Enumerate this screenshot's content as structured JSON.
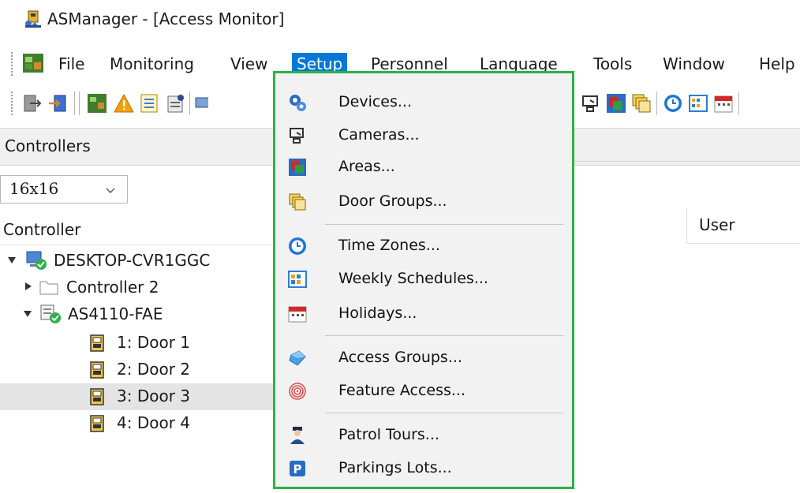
{
  "window": {
    "title": "ASManager - [Access Monitor]",
    "app_icon": "access-manager-app-icon"
  },
  "menubar": {
    "items": [
      {
        "label": "File"
      },
      {
        "label": "Monitoring"
      },
      {
        "label": "View"
      },
      {
        "label": "Setup"
      },
      {
        "label": "Personnel"
      },
      {
        "label": "Language"
      },
      {
        "label": "Tools"
      },
      {
        "label": "Window"
      },
      {
        "label": "Help"
      }
    ]
  },
  "toolbar": {
    "icons": [
      "logout-icon",
      "login-icon",
      "monitor-icon",
      "alarm-warning-icon",
      "list-icon",
      "report-icon",
      "camera-icon",
      "area-icon",
      "door-group-icon",
      "clock-icon",
      "schedule-icon",
      "calendar-icon"
    ]
  },
  "left_panel": {
    "header": "Controllers",
    "icon_size_select": {
      "value": "16x16"
    },
    "column_controller": "Controller",
    "column_user": "User",
    "tree": [
      {
        "label": "DESKTOP-CVR1GGC",
        "icon": "computer-online-icon",
        "level": 0,
        "expanded": true
      },
      {
        "label": "Controller 2",
        "icon": "folder-icon",
        "level": 1,
        "expanded": false
      },
      {
        "label": "AS4110-FAE",
        "icon": "controller-online-icon",
        "level": 1,
        "expanded": true
      },
      {
        "label": "1: Door 1",
        "icon": "door-icon",
        "level": 2
      },
      {
        "label": "2: Door 2",
        "icon": "door-icon",
        "level": 2
      },
      {
        "label": "3: Door 3",
        "icon": "door-icon",
        "level": 2,
        "selected": true
      },
      {
        "label": "4: Door 4",
        "icon": "door-icon",
        "level": 2
      }
    ]
  },
  "setup_menu": {
    "highlight_color": "#2eb04a",
    "items": [
      {
        "label": "Devices...",
        "icon": "devices-gear-icon"
      },
      {
        "label": "Cameras...",
        "icon": "camera-icon"
      },
      {
        "label": "Areas...",
        "icon": "area-icon"
      },
      {
        "label": "Door Groups...",
        "icon": "door-group-icon"
      },
      {
        "label": "Time Zones...",
        "icon": "clock-icon"
      },
      {
        "label": "Weekly Schedules...",
        "icon": "weekly-schedule-icon"
      },
      {
        "label": "Holidays...",
        "icon": "calendar-icon"
      },
      {
        "label": "Access Groups...",
        "icon": "access-group-icon"
      },
      {
        "label": "Feature Access...",
        "icon": "fingerprint-icon"
      },
      {
        "label": "Patrol Tours...",
        "icon": "guard-icon"
      },
      {
        "label": "Parkings Lots...",
        "icon": "parking-icon"
      }
    ]
  },
  "colors": {
    "menu_selected_bg": "#0078d7",
    "menu_bg": "#f2f2f2",
    "menu_border": "#2eb04a"
  }
}
